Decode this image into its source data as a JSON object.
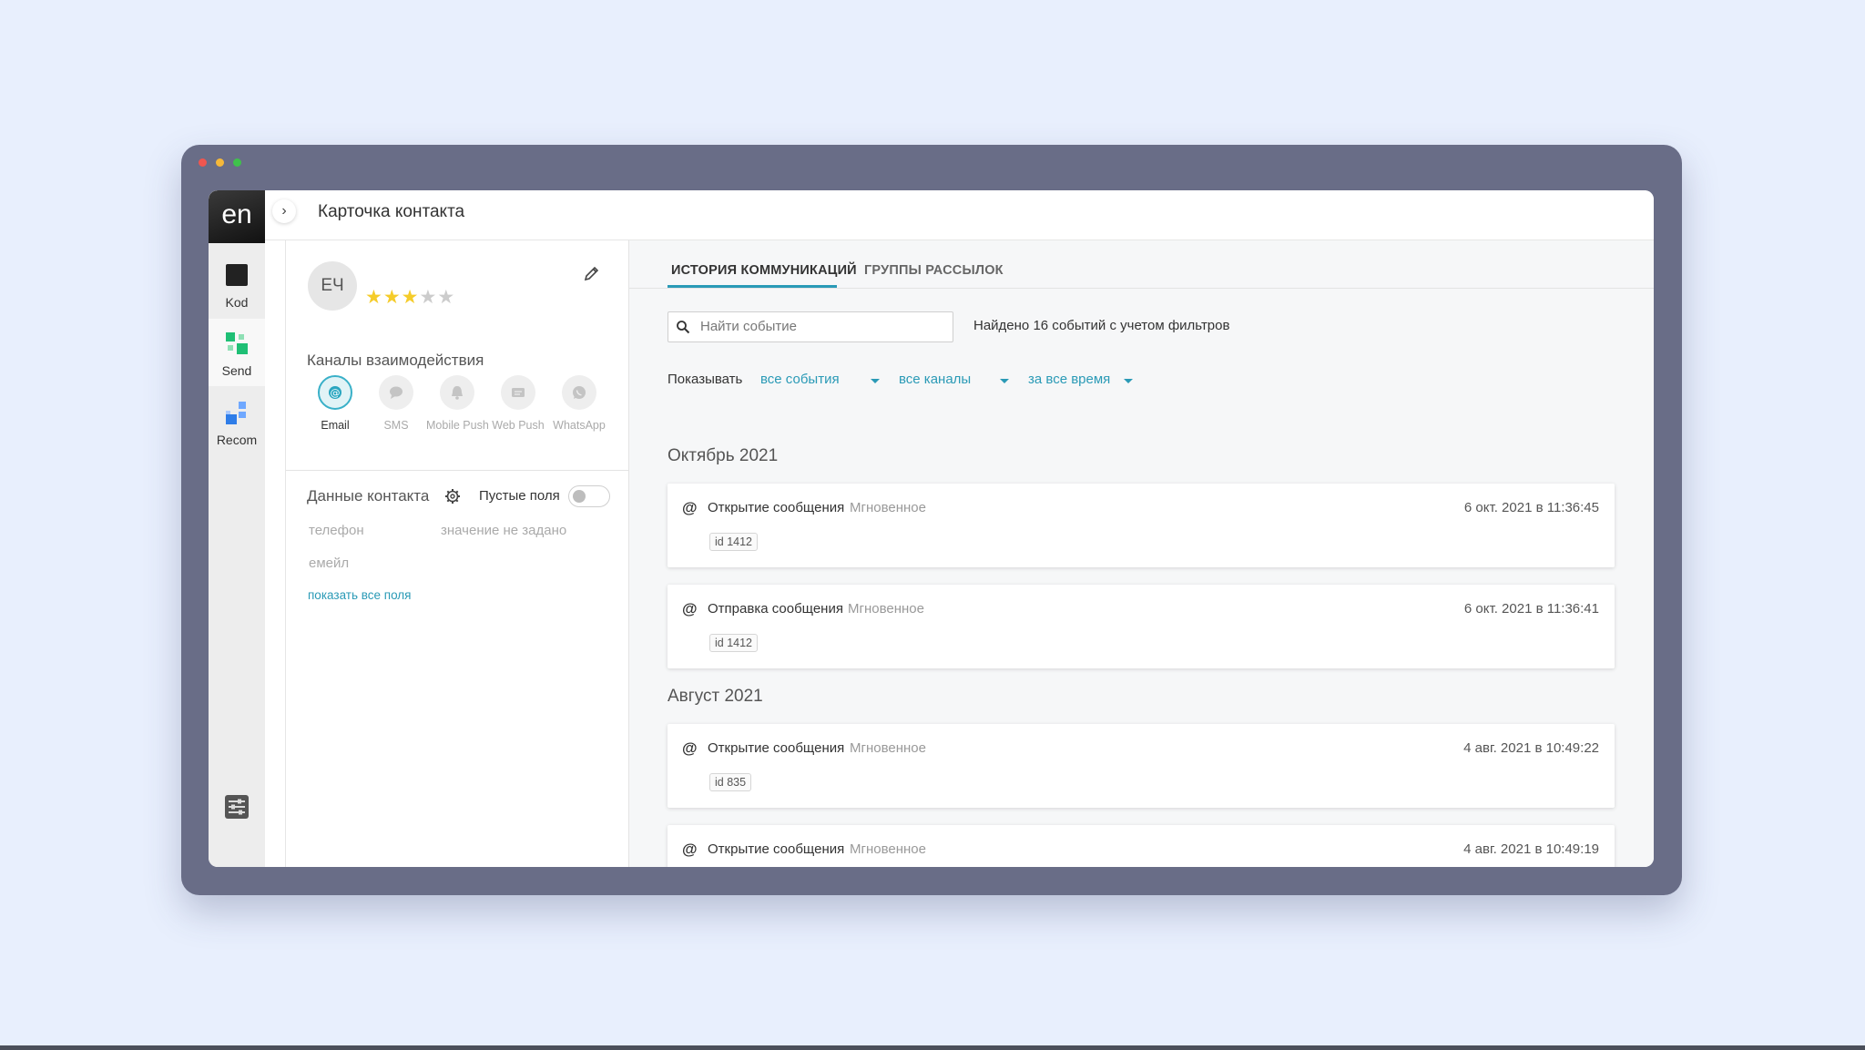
{
  "app": {
    "logo": "en",
    "page_title": "Карточка контакта",
    "rail": [
      {
        "label": "Kod",
        "icon": "kod-icon"
      },
      {
        "label": "Send",
        "icon": "send-icon"
      },
      {
        "label": "Recom",
        "icon": "recom-icon"
      }
    ]
  },
  "contact": {
    "initials": "ЕЧ",
    "rating": 3,
    "rating_max": 5,
    "channels_title": "Каналы взаимодействия",
    "channels": [
      {
        "label": "Email",
        "active": true,
        "icon": "email-icon"
      },
      {
        "label": "SMS",
        "active": false,
        "icon": "sms-icon"
      },
      {
        "label": "Mobile Push",
        "active": false,
        "icon": "mobile-push-icon"
      },
      {
        "label": "Web Push",
        "active": false,
        "icon": "web-push-icon"
      },
      {
        "label": "WhatsApp",
        "active": false,
        "icon": "whatsapp-icon"
      }
    ],
    "data_title": "Данные контакта",
    "empty_fields_label": "Пустые поля",
    "empty_fields_on": false,
    "fields": [
      {
        "name": "телефон",
        "value": "значение не задано"
      },
      {
        "name": "емейл",
        "value": ""
      }
    ],
    "show_all": "показать все поля"
  },
  "main": {
    "tabs": [
      {
        "label": "ИСТОРИЯ КОММУНИКАЦИЙ",
        "active": true
      },
      {
        "label": "ГРУППЫ РАССЫЛОК",
        "active": false
      }
    ],
    "search_placeholder": "Найти событие",
    "found_text": "Найдено 16 событий с учетом фильтров",
    "show_label": "Показывать",
    "filters": [
      "все события",
      "все каналы",
      "за все время"
    ],
    "months": [
      {
        "title": "Октябрь 2021",
        "events": [
          {
            "name": "Открытие сообщения",
            "type": "Мгновенное",
            "date": "6 окт. 2021 в 11:36:45",
            "id": "id 1412"
          },
          {
            "name": "Отправка сообщения",
            "type": "Мгновенное",
            "date": "6 окт. 2021 в 11:36:41",
            "id": "id 1412"
          }
        ]
      },
      {
        "title": "Август 2021",
        "events": [
          {
            "name": "Открытие сообщения",
            "type": "Мгновенное",
            "date": "4 авг. 2021 в 10:49:22",
            "id": "id 835"
          },
          {
            "name": "Открытие сообщения",
            "type": "Мгновенное",
            "date": "4 авг. 2021 в 10:49:19",
            "id": ""
          }
        ]
      }
    ]
  },
  "colors": {
    "accent": "#2a9ab6",
    "frame": "#696d87",
    "background": "#e8effd",
    "star": "#f5cc2a"
  }
}
